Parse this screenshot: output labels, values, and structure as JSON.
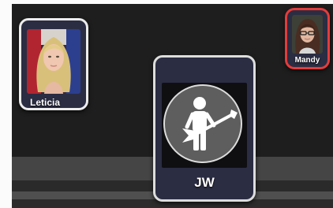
{
  "profiles": [
    {
      "name": "Leticia",
      "avatar": "woman-blonde-photo"
    },
    {
      "name": "Mandy",
      "avatar": "girl-glasses-photo",
      "selected": true,
      "highlight_color": "#e33c3c"
    },
    {
      "name": "JW",
      "avatar": "guitar-player-icon",
      "focused": true
    }
  ]
}
